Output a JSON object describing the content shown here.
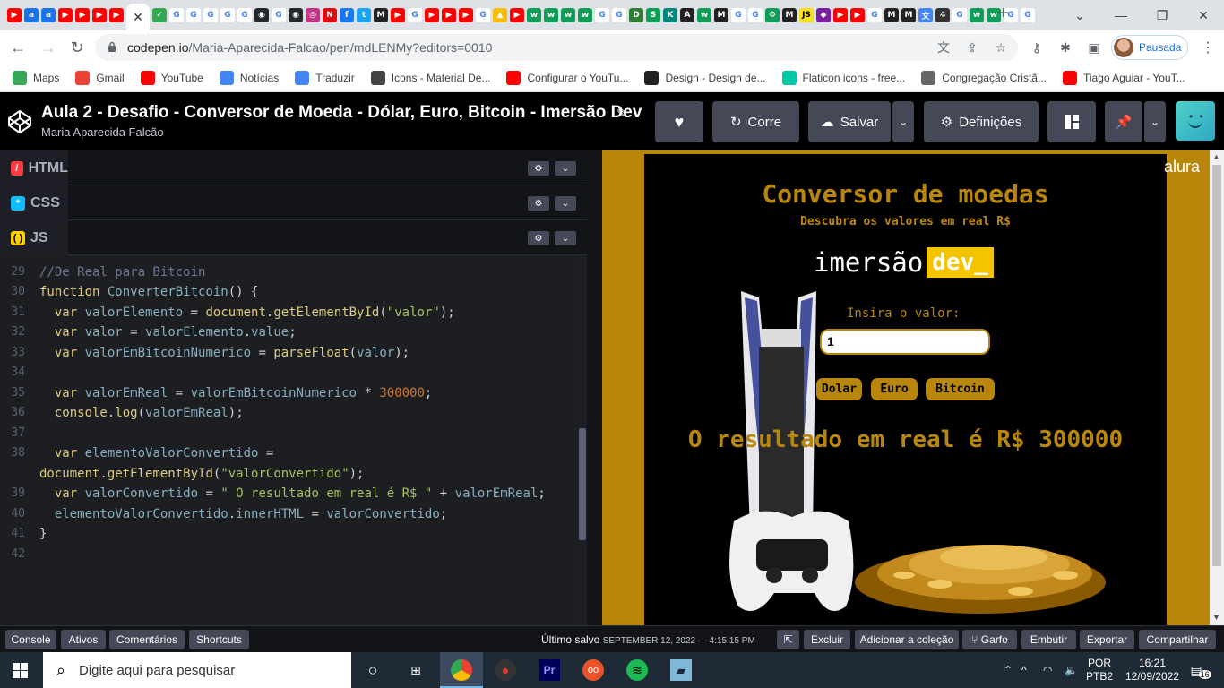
{
  "browser": {
    "url_host": "codepen.io",
    "url_path": "/Maria-Aparecida-Falcao/pen/mdLENMy?editors=0010",
    "profile_label": "Pausada",
    "bookmarks": [
      {
        "label": "Maps",
        "icon": "maps-icon",
        "color": "#34a853"
      },
      {
        "label": "Gmail",
        "icon": "gmail-icon",
        "color": "#ea4335"
      },
      {
        "label": "YouTube",
        "icon": "youtube-icon",
        "color": "#ff0000"
      },
      {
        "label": "Notícias",
        "icon": "news-icon",
        "color": "#4285f4"
      },
      {
        "label": "Traduzir",
        "icon": "translate-icon",
        "color": "#4285f4"
      },
      {
        "label": "Icons - Material De...",
        "icon": "material-icon",
        "color": "#444444"
      },
      {
        "label": "Configurar o YouTu...",
        "icon": "youtube-icon",
        "color": "#ff0000"
      },
      {
        "label": "Design - Design de...",
        "icon": "design-icon",
        "color": "#222222"
      },
      {
        "label": "Flaticon icons - free...",
        "icon": "flaticon-icon",
        "color": "#00c9a7"
      },
      {
        "label": "Congregação Cristã...",
        "icon": "globe-icon",
        "color": "#666666"
      },
      {
        "label": "Tiago Aguiar - YouT...",
        "icon": "youtube-icon",
        "color": "#ff0000"
      }
    ]
  },
  "codepen": {
    "title": "Aula 2 - Desafio - Conversor de Moeda - Dólar, Euro, Bitcoin - Imersão Dev",
    "author": "Maria Aparecida Falcão",
    "buttons": {
      "run": "Corre",
      "save": "Salvar",
      "settings": "Definições"
    },
    "panels": {
      "html": "HTML",
      "css": "CSS",
      "js": "JS"
    }
  },
  "code": {
    "lines": [
      {
        "n": "28",
        "text": ""
      },
      {
        "n": "29",
        "text": "//De Real para Bitcoin"
      },
      {
        "n": "30",
        "text": "function ConverterBitcoin() {"
      },
      {
        "n": "31",
        "text": "  var valorElemento = document.getElementById(\"valor\");"
      },
      {
        "n": "32",
        "text": "  var valor = valorElemento.value;"
      },
      {
        "n": "33",
        "text": "  var valorEmBitcoinNumerico = parseFloat(valor);"
      },
      {
        "n": "34",
        "text": ""
      },
      {
        "n": "35",
        "text": "  var valorEmReal = valorEmBitcoinNumerico * 300000;"
      },
      {
        "n": "36",
        "text": "  console.log(valorEmReal);"
      },
      {
        "n": "37",
        "text": ""
      },
      {
        "n": "38",
        "text": "  var elementoValorConvertido ="
      },
      {
        "n": "",
        "text": "document.getElementById(\"valorConvertido\");"
      },
      {
        "n": "39",
        "text": "  var valorConvertido = \" O resultado em real é R$ \" + valorEmReal;"
      },
      {
        "n": "40",
        "text": "  elementoValorConvertido.innerHTML = valorConvertido;"
      },
      {
        "n": "41",
        "text": "}"
      },
      {
        "n": "42",
        "text": ""
      }
    ]
  },
  "preview": {
    "title": "Conversor de moedas",
    "subtitle": "Descubra os valores em real R$",
    "brand_word": "imersão",
    "brand_tag": "dev_",
    "input_label": "Insira o valor:",
    "input_value": "1",
    "buttons": [
      "Dolar",
      "Euro",
      "Bitcoin"
    ],
    "result": "O resultado em real é R$ 300000",
    "corner_brand": "alura",
    "accent": "#b8860b"
  },
  "footer": {
    "console": "Console",
    "assets": "Ativos",
    "comments": "Comentários",
    "shortcuts": "Shortcuts",
    "saved_label": "Último salvo",
    "saved_time": "SEPTEMBER 12, 2022 — 4:15:15 PM",
    "close": "Excluir",
    "collection": "Adicionar a coleção",
    "fork": "Garfo",
    "embed": "Embutir",
    "export": "Exportar",
    "share": "Compartilhar"
  },
  "taskbar": {
    "search_placeholder": "Digite aqui para pesquisar",
    "lang": "POR",
    "layout": "PTB2",
    "time": "16:21",
    "date": "12/09/2022",
    "notifications": "16"
  }
}
